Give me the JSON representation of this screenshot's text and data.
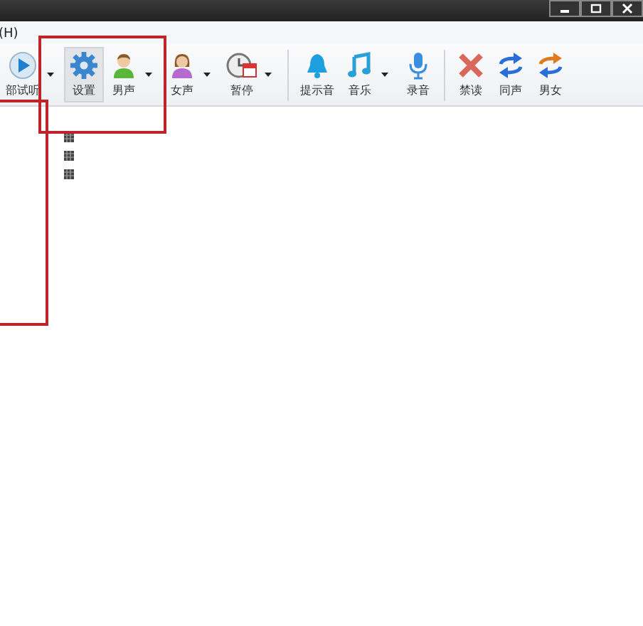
{
  "window": {
    "controls": [
      {
        "kind": "minimize"
      },
      {
        "kind": "restore"
      },
      {
        "kind": "close"
      }
    ]
  },
  "menu": {
    "label": "(H)"
  },
  "toolbar": [
    {
      "kind": "button",
      "label": "部试听",
      "selected": false,
      "has_menu": true
    },
    {
      "kind": "button",
      "label": "设置",
      "selected": true,
      "has_menu": false
    },
    {
      "kind": "button",
      "label": "男声",
      "selected": false,
      "has_menu": true
    },
    {
      "kind": "button",
      "label": "女声",
      "selected": false,
      "has_menu": true
    },
    {
      "kind": "button",
      "label": "暂停",
      "selected": false,
      "has_menu": true
    },
    {
      "kind": "separator"
    },
    {
      "kind": "button",
      "label": "提示音",
      "selected": false,
      "has_menu": false
    },
    {
      "kind": "button",
      "label": "音乐",
      "selected": false,
      "has_menu": true
    },
    {
      "kind": "button",
      "label": "录音",
      "selected": false,
      "has_menu": false
    },
    {
      "kind": "separator"
    },
    {
      "kind": "button",
      "label": "禁读",
      "selected": false,
      "has_menu": false
    },
    {
      "kind": "button",
      "label": "同声",
      "selected": false,
      "has_menu": false
    },
    {
      "kind": "button",
      "label": "男女",
      "selected": false,
      "has_menu": false
    }
  ],
  "annotations": [
    {
      "kind": "box"
    },
    {
      "kind": "box"
    }
  ]
}
